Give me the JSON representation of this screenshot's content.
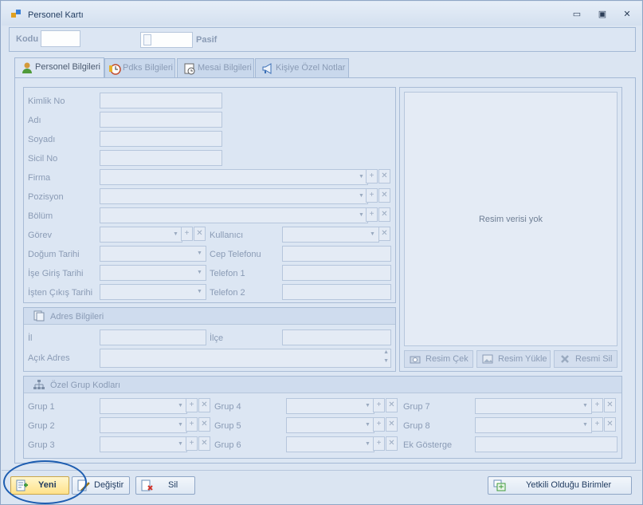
{
  "window": {
    "title": "Personel Kartı",
    "minimize": "▭",
    "restore": "▣",
    "close": "✕"
  },
  "topbar": {
    "kodu_label": "Kodu",
    "kodu_value": "",
    "pasif_label": "Pasif"
  },
  "tabs": [
    {
      "label": "Personel Bilgileri"
    },
    {
      "label": "Pdks Bilgileri"
    },
    {
      "label": "Mesai Bilgileri"
    },
    {
      "label": "Kişiye Özel Notlar"
    }
  ],
  "personal": {
    "kimlik_no": "Kimlik No",
    "adi": "Adı",
    "soyadi": "Soyadı",
    "sicil_no": "Sicil No",
    "firma": "Firma",
    "pozisyon": "Pozisyon",
    "bolum": "Bölüm",
    "gorev": "Görev",
    "kullanici": "Kullanıcı",
    "dogum_tarihi": "Doğum Tarihi",
    "cep_telefonu": "Cep Telefonu",
    "ise_giris_tarihi": "İşe Giriş Tarihi",
    "telefon1": "Telefon 1",
    "isten_cikis_tarihi": "İşten Çıkış Tarihi",
    "telefon2": "Telefon 2"
  },
  "address": {
    "title": "Adres Bilgileri",
    "il": "İl",
    "ilce": "İlçe",
    "acik_adres": "Açık Adres"
  },
  "photo": {
    "no_image": "Resim verisi yok",
    "cek": "Resim Çek",
    "yukle": "Resim Yükle",
    "sil": "Resmi Sil"
  },
  "groups": {
    "title": "Özel Grup Kodları",
    "g1": "Grup 1",
    "g2": "Grup 2",
    "g3": "Grup 3",
    "g4": "Grup 4",
    "g5": "Grup 5",
    "g6": "Grup 6",
    "g7": "Grup 7",
    "g8": "Grup 8",
    "ek": "Ek Gösterge"
  },
  "actions": {
    "yeni": "Yeni",
    "degistir": "Değiştir",
    "sil": "Sil",
    "yetkili": "Yetkili Olduğu Birimler"
  },
  "colors": {
    "accent": "#1d5db0",
    "window_bg": "#dbe5f2"
  }
}
